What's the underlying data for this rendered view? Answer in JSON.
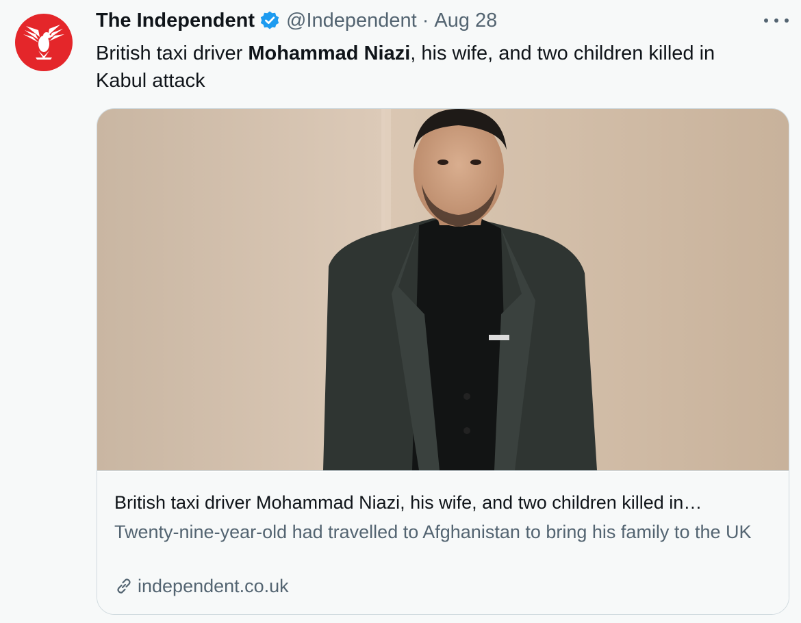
{
  "tweet": {
    "display_name": "The Independent",
    "handle": "@Independent",
    "separator": "·",
    "date": "Aug 28",
    "text_before": "British taxi driver ",
    "text_bold": "Mohammad Niazi",
    "text_after": ", his wife, and two children killed in Kabul attack"
  },
  "card": {
    "title": "British taxi driver Mohammad Niazi, his wife, and two children killed in…",
    "description": "Twenty-nine-year-old had travelled to Afghanistan to bring his family to the UK",
    "domain": "independent.co.uk"
  },
  "icons": {
    "avatar": "eagle-logo",
    "verified": "verified-badge-icon",
    "more": "more-options-icon",
    "link": "link-icon"
  },
  "colors": {
    "background": "#f7f9f9",
    "avatar_red": "#e4262a",
    "verified_blue": "#1d9bf0",
    "secondary_text": "#536471",
    "primary_text": "#0f1419",
    "border": "#cfd9de"
  }
}
